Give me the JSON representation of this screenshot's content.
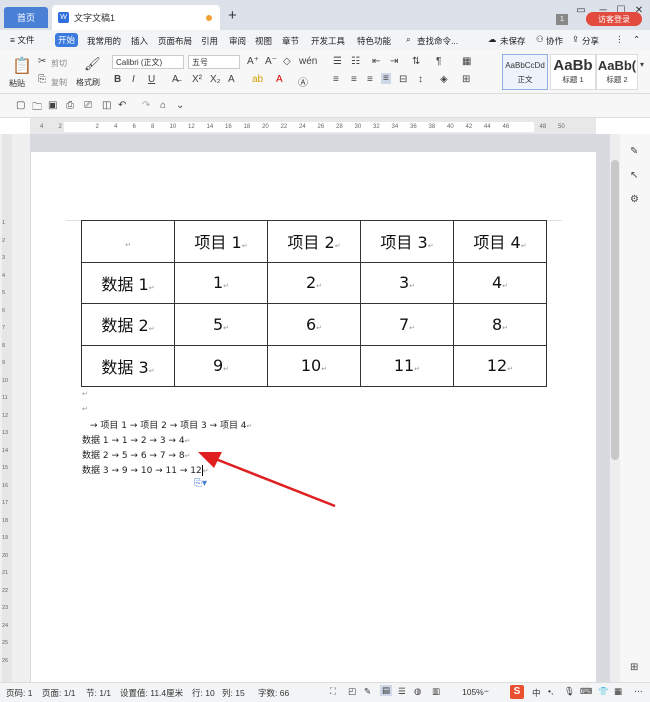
{
  "tabs": {
    "home": "首页",
    "doc": "文字文稿1",
    "new": "+"
  },
  "window": {
    "badge": "1",
    "visitor": "访客登录"
  },
  "menu": {
    "file": "≡ 文件",
    "items": [
      "开始",
      "我常用的",
      "插入",
      "页面布局",
      "引用",
      "审阅",
      "视图",
      "章节",
      "开发工具",
      "特色功能"
    ],
    "search": "查找命令...",
    "save": "未保存",
    "collab": "协作",
    "share": "分享"
  },
  "ribbon": {
    "paste": "粘贴",
    "cut": "剪切",
    "copy": "复制",
    "format": "格式刷",
    "font": "Calibri (正文)",
    "size": "五号",
    "styles": [
      {
        "preview": "AaBbCcDd",
        "name": "正文"
      },
      {
        "preview": "AaBb",
        "name": "标题 1"
      },
      {
        "preview": "AaBb(",
        "name": "标题 2"
      }
    ]
  },
  "ruler": {
    "numbers": [
      "4",
      "2",
      "",
      "2",
      "4",
      "6",
      "8",
      "10",
      "12",
      "14",
      "16",
      "18",
      "20",
      "22",
      "24",
      "26",
      "28",
      "30",
      "32",
      "34",
      "36",
      "38",
      "40",
      "42",
      "44",
      "46",
      "",
      "48",
      "50"
    ]
  },
  "table": {
    "header": [
      "",
      "项目 1",
      "项目 2",
      "项目 3",
      "项目 4"
    ],
    "rows": [
      [
        "数据 1",
        "1",
        "2",
        "3",
        "4"
      ],
      [
        "数据 2",
        "5",
        "6",
        "7",
        "8"
      ],
      [
        "数据 3",
        "9",
        "10",
        "11",
        "12"
      ]
    ]
  },
  "text_lines": [
    "→ 项目 1 → 项目 2 → 项目 3 → 项目 4",
    "数据 1 → 1 → 2 → 3 → 4",
    "数据 2 → 5 → 6 → 7 → 8",
    "数据 3 → 9 → 10 → 11 → 12"
  ],
  "status": {
    "page": "页码: 1",
    "pages": "页面: 1/1",
    "section": "节: 1/1",
    "setting": "设置值: 11.4厘米",
    "row": "行: 10",
    "col": "列: 15",
    "words": "字数: 66",
    "zoom": "105%",
    "ime": "中"
  },
  "colors": {
    "accent": "#3b7be0",
    "visitor": "#e14a3c",
    "arrow": "#e02020"
  }
}
